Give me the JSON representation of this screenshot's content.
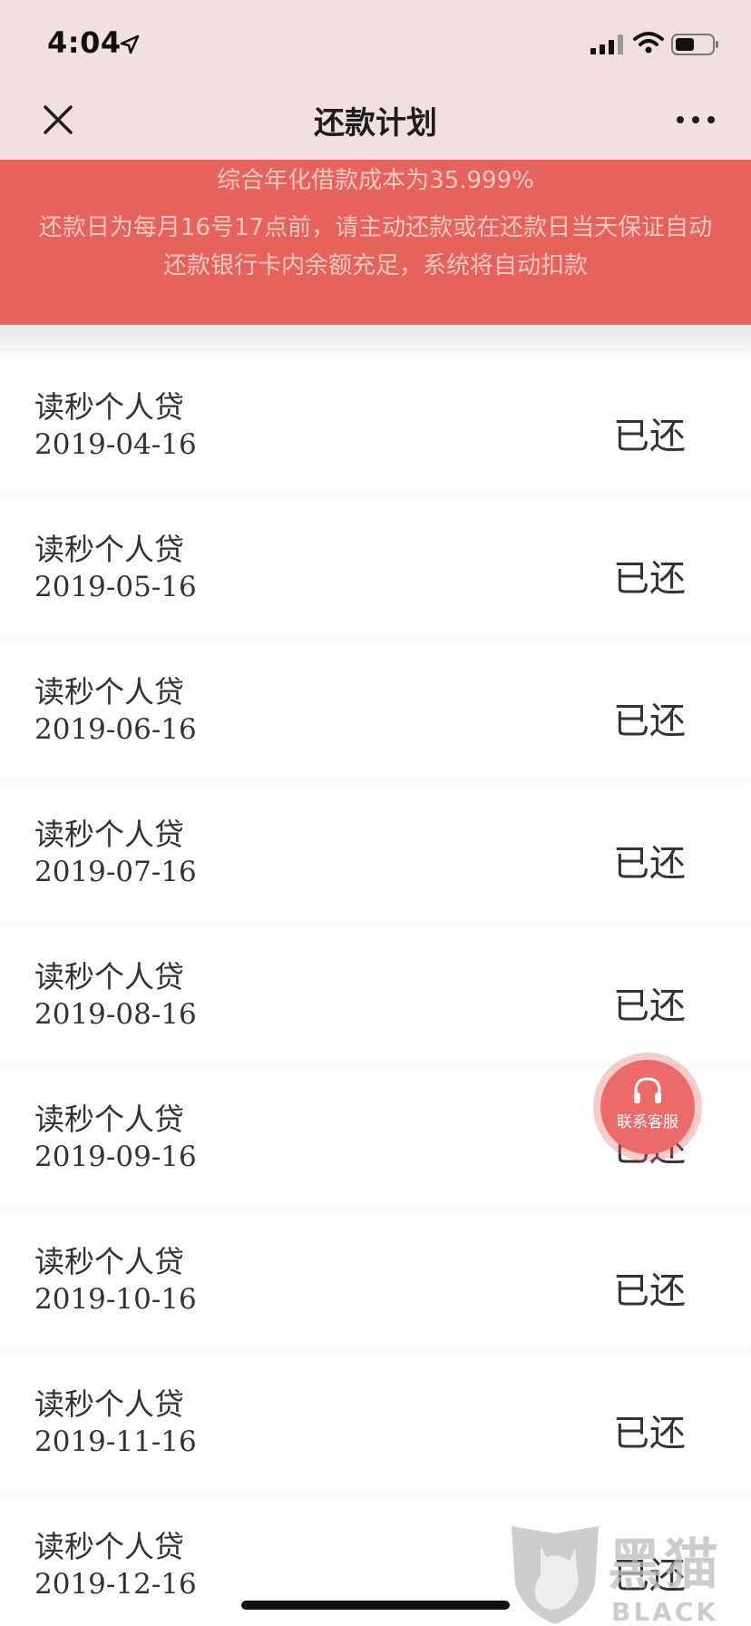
{
  "status_bar": {
    "time": "4:04"
  },
  "nav": {
    "title": "还款计划"
  },
  "banner": {
    "rate_text": "综合年化借款成本为35.999%",
    "note_text": "还款日为每月16号17点前，请主动还款或在还款日当天保证自动还款银行卡内余额充足，系统将自动扣款"
  },
  "repayments": [
    {
      "name": "读秒个人贷",
      "date": "2019-04-16",
      "status": "已还"
    },
    {
      "name": "读秒个人贷",
      "date": "2019-05-16",
      "status": "已还"
    },
    {
      "name": "读秒个人贷",
      "date": "2019-06-16",
      "status": "已还"
    },
    {
      "name": "读秒个人贷",
      "date": "2019-07-16",
      "status": "已还"
    },
    {
      "name": "读秒个人贷",
      "date": "2019-08-16",
      "status": "已还"
    },
    {
      "name": "读秒个人贷",
      "date": "2019-09-16",
      "status": "已还"
    },
    {
      "name": "读秒个人贷",
      "date": "2019-10-16",
      "status": "已还"
    },
    {
      "name": "读秒个人贷",
      "date": "2019-11-16",
      "status": "已还"
    },
    {
      "name": "读秒个人贷",
      "date": "2019-12-16",
      "status": "已还"
    }
  ],
  "service_button": {
    "label": "联系客服",
    "icon": "headset-icon"
  },
  "watermark": {
    "cn": "黑猫",
    "en": "BLACK CAT"
  },
  "colors": {
    "banner_bg": "#e5625d",
    "header_bg": "#f2dfe0",
    "service_bg": "#ec6b6a"
  }
}
